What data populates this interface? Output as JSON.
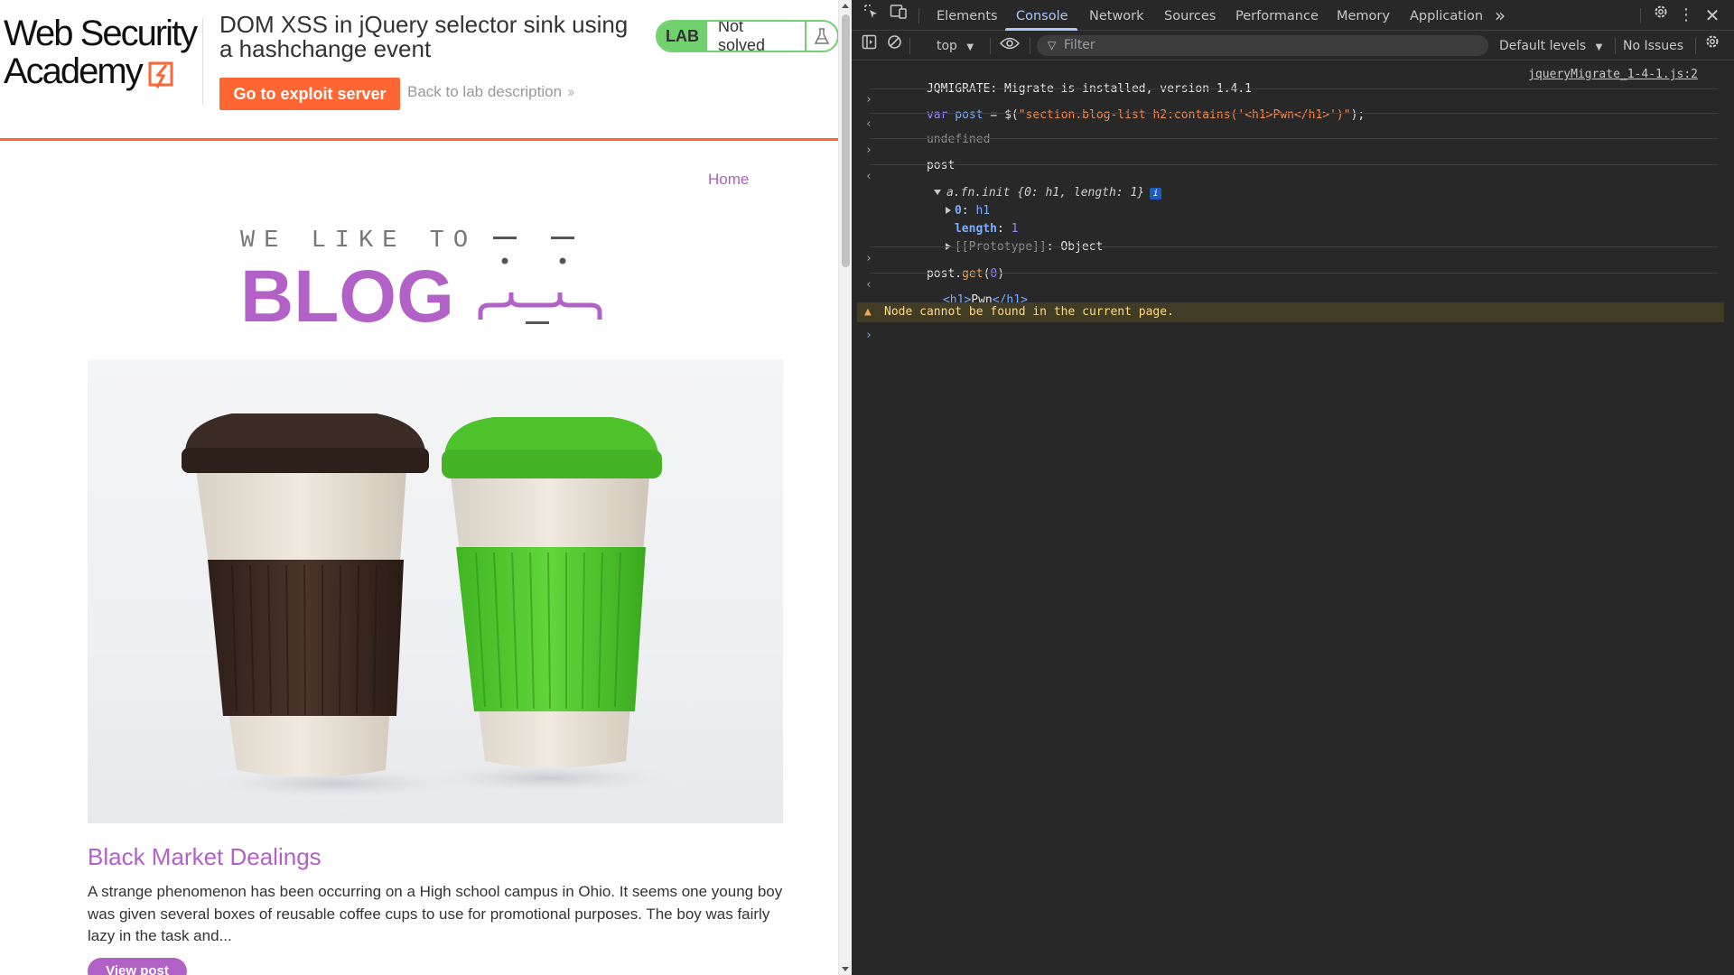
{
  "academy": {
    "logo_line1": "Web Security",
    "logo_line2": "Academy",
    "lab_title": "DOM XSS in jQuery selector sink using a hashchange event",
    "exploit_button": "Go to exploit server",
    "back_link": "Back to lab description",
    "lab_badge": "LAB",
    "lab_status": "Not solved",
    "accent": "#ff6633",
    "status_color": "#70d16d"
  },
  "blog": {
    "nav_home": "Home",
    "tagline": "WE LIKE TO",
    "word": "BLOG",
    "accent": "#b262c7",
    "post": {
      "title": "Black Market Dealings",
      "summary": "A strange phenomenon has been occurring on a High school campus in Ohio. It seems one young boy was given several boxes of reusable coffee cups to use for promotional purposes. The boy was fairly lazy in the task and...",
      "button": "View post"
    }
  },
  "devtools": {
    "tabs": [
      {
        "label": "Elements",
        "active": false
      },
      {
        "label": "Console",
        "active": true
      },
      {
        "label": "Network",
        "active": false
      },
      {
        "label": "Sources",
        "active": false
      },
      {
        "label": "Performance",
        "active": false
      },
      {
        "label": "Memory",
        "active": false
      },
      {
        "label": "Application",
        "active": false
      }
    ],
    "toolbar": {
      "context": "top",
      "filter_placeholder": "Filter",
      "levels": "Default levels",
      "issues": "No Issues"
    },
    "console": {
      "log1_text": "JQMIGRATE: Migrate is installed, version 1.4.1",
      "log1_source": "jqueryMigrate_1-4-1.js:2",
      "in1_kw": "var",
      "in1_var": "post",
      "in1_eq": " = $(",
      "in1_str": "\"section.blog-list h2:contains('<h1>Pwn</h1>')\"",
      "in1_end": ");",
      "out1": "undefined",
      "in2": "post",
      "out2_head_name": "a.fn.init",
      "out2_head_rest": "{0: h1, length: 1}",
      "out2_item0_key": "0",
      "out2_item0_val": "h1",
      "out2_length_key": "length",
      "out2_length_val": "1",
      "out2_proto_key": "[[Prototype]]",
      "out2_proto_val": "Object",
      "in3_obj": "post.",
      "in3_fn": "get",
      "in3_args_open": "(",
      "in3_args_num": "0",
      "in3_args_close": ")",
      "out3_open": "<h1>",
      "out3_text": "Pwn",
      "out3_close": "</h1>",
      "warning": "Node cannot be found in the current page."
    }
  }
}
